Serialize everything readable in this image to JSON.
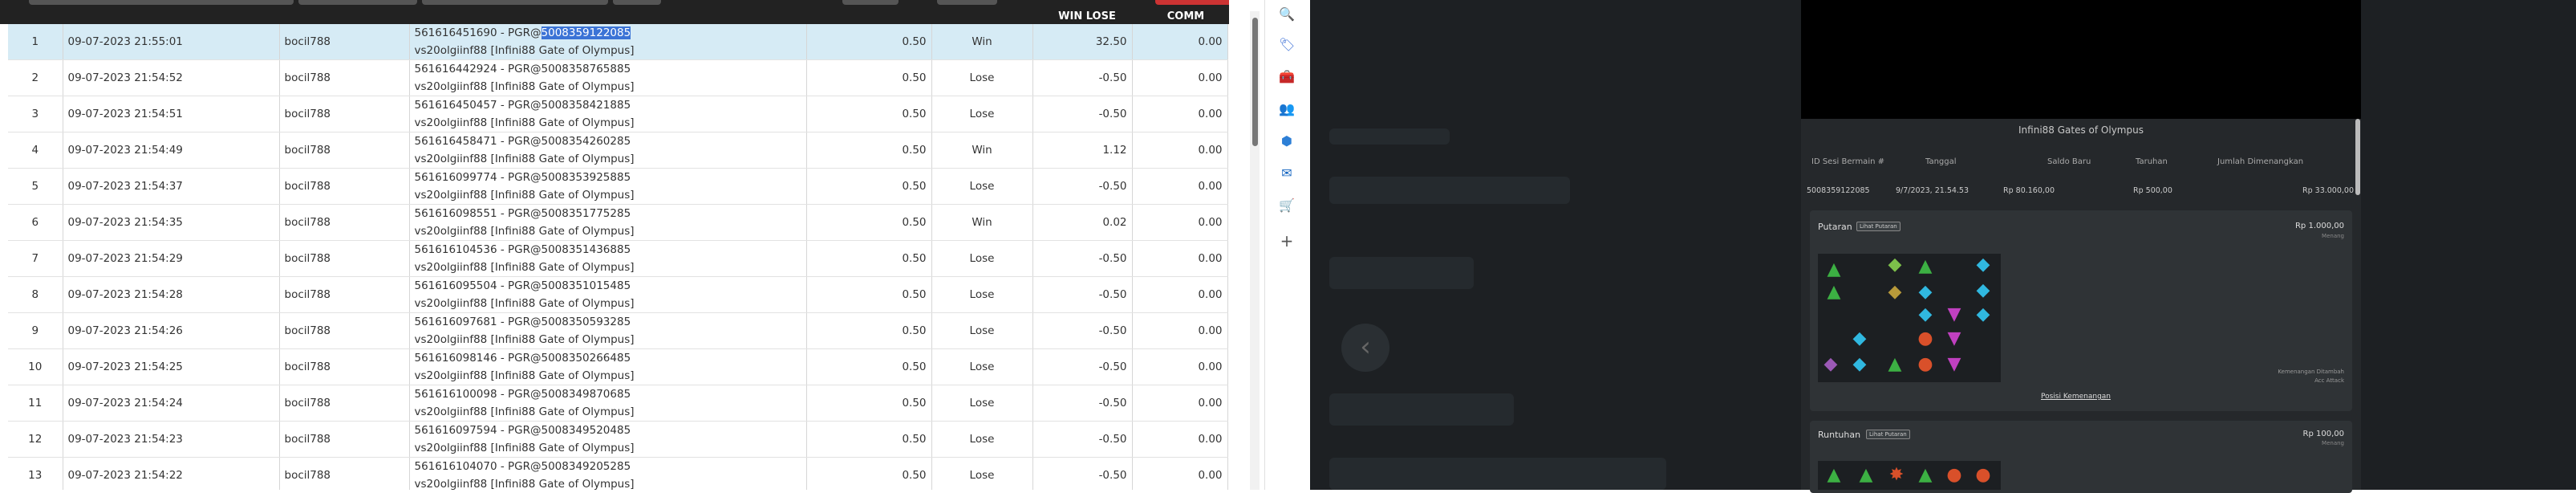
{
  "table": {
    "headers": {
      "win_lose": "WIN LOSE",
      "comm": "COMM"
    },
    "rows": [
      {
        "no": "1",
        "date": "09-07-2023 21:55:01",
        "user": "bocil788",
        "id_pre": "561616451690 - PGR@",
        "id_hl": "5008359122085",
        "game": "vs20olgiinf88 [Infini88 Gate of Olympus]",
        "stake": "0.50",
        "status": "Win",
        "amount": "32.50",
        "comm": "0.00"
      },
      {
        "no": "2",
        "date": "09-07-2023 21:54:52",
        "user": "bocil788",
        "id": "561616442924 - PGR@5008358765885",
        "game": "vs20olgiinf88 [Infini88 Gate of Olympus]",
        "stake": "0.50",
        "status": "Lose",
        "amount": "-0.50",
        "comm": "0.00"
      },
      {
        "no": "3",
        "date": "09-07-2023 21:54:51",
        "user": "bocil788",
        "id": "561616450457 - PGR@5008358421885",
        "game": "vs20olgiinf88 [Infini88 Gate of Olympus]",
        "stake": "0.50",
        "status": "Lose",
        "amount": "-0.50",
        "comm": "0.00"
      },
      {
        "no": "4",
        "date": "09-07-2023 21:54:49",
        "user": "bocil788",
        "id": "561616458471 - PGR@5008354260285",
        "game": "vs20olgiinf88 [Infini88 Gate of Olympus]",
        "stake": "0.50",
        "status": "Win",
        "amount": "1.12",
        "comm": "0.00"
      },
      {
        "no": "5",
        "date": "09-07-2023 21:54:37",
        "user": "bocil788",
        "id": "561616099774 - PGR@5008353925885",
        "game": "vs20olgiinf88 [Infini88 Gate of Olympus]",
        "stake": "0.50",
        "status": "Lose",
        "amount": "-0.50",
        "comm": "0.00"
      },
      {
        "no": "6",
        "date": "09-07-2023 21:54:35",
        "user": "bocil788",
        "id": "561616098551 - PGR@5008351775285",
        "game": "vs20olgiinf88 [Infini88 Gate of Olympus]",
        "stake": "0.50",
        "status": "Win",
        "amount": "0.02",
        "comm": "0.00"
      },
      {
        "no": "7",
        "date": "09-07-2023 21:54:29",
        "user": "bocil788",
        "id": "561616104536 - PGR@5008351436885",
        "game": "vs20olgiinf88 [Infini88 Gate of Olympus]",
        "stake": "0.50",
        "status": "Lose",
        "amount": "-0.50",
        "comm": "0.00"
      },
      {
        "no": "8",
        "date": "09-07-2023 21:54:28",
        "user": "bocil788",
        "id": "561616095504 - PGR@5008351015485",
        "game": "vs20olgiinf88 [Infini88 Gate of Olympus]",
        "stake": "0.50",
        "status": "Lose",
        "amount": "-0.50",
        "comm": "0.00"
      },
      {
        "no": "9",
        "date": "09-07-2023 21:54:26",
        "user": "bocil788",
        "id": "561616097681 - PGR@5008350593285",
        "game": "vs20olgiinf88 [Infini88 Gate of Olympus]",
        "stake": "0.50",
        "status": "Lose",
        "amount": "-0.50",
        "comm": "0.00"
      },
      {
        "no": "10",
        "date": "09-07-2023 21:54:25",
        "user": "bocil788",
        "id": "561616098146 - PGR@5008350266485",
        "game": "vs20olgiinf88 [Infini88 Gate of Olympus]",
        "stake": "0.50",
        "status": "Lose",
        "amount": "-0.50",
        "comm": "0.00"
      },
      {
        "no": "11",
        "date": "09-07-2023 21:54:24",
        "user": "bocil788",
        "id": "561616100098 - PGR@5008349870685",
        "game": "vs20olgiinf88 [Infini88 Gate of Olympus]",
        "stake": "0.50",
        "status": "Lose",
        "amount": "-0.50",
        "comm": "0.00"
      },
      {
        "no": "12",
        "date": "09-07-2023 21:54:23",
        "user": "bocil788",
        "id": "561616097594 - PGR@5008349520485",
        "game": "vs20olgiinf88 [Infini88 Gate of Olympus]",
        "stake": "0.50",
        "status": "Lose",
        "amount": "-0.50",
        "comm": "0.00"
      },
      {
        "no": "13",
        "date": "09-07-2023 21:54:22",
        "user": "bocil788",
        "id": "561616104070 - PGR@5008349205285",
        "game": "vs20olgiinf88 [Infini88 Gate of Olympus]",
        "stake": "0.50",
        "status": "Lose",
        "amount": "-0.50",
        "comm": "0.00"
      }
    ]
  },
  "colors": {
    "win": "#2a8a2a",
    "lose": "#d32a2a",
    "selected_row": "#d6ebf5",
    "highlight": "#3b73d6",
    "dark_bg": "#1d2023"
  },
  "edge_sidebar": {
    "icons": [
      "search-icon",
      "tag-icon",
      "toolbox-icon",
      "people-icon",
      "copilot-icon",
      "outlook-icon",
      "shopping-icon",
      "add-icon"
    ],
    "glyphs": [
      "🔍",
      "🏷",
      "🧰",
      "👥",
      "⬢",
      "✉",
      "🛒",
      "+"
    ]
  },
  "panel": {
    "title": "Infini88 Gates of Olympus",
    "headers": {
      "session": "ID Sesi Bermain #",
      "date": "Tanggal",
      "balance": "Saldo Baru",
      "bet": "Taruhan",
      "win": "Jumlah Dimenangkan"
    },
    "values": {
      "session": "5008359122085",
      "date": "9/7/2023, 21.54.53",
      "balance": "Rp 80.160,00",
      "bet": "Rp 500,00",
      "win": "Rp 33.000,00"
    },
    "spin": {
      "title": "Putaran",
      "button": "Lihat Putaran",
      "amount": "Rp 1.000,00",
      "sub": "Menang",
      "note1": "Kemenangan Ditambah",
      "note2": "Acc Attack",
      "link": "Posisi Kemenangan"
    },
    "tumble": {
      "title": "Runtuhan",
      "button": "Lihat Putaran",
      "amount": "Rp 100,00",
      "sub": "Menang"
    }
  }
}
